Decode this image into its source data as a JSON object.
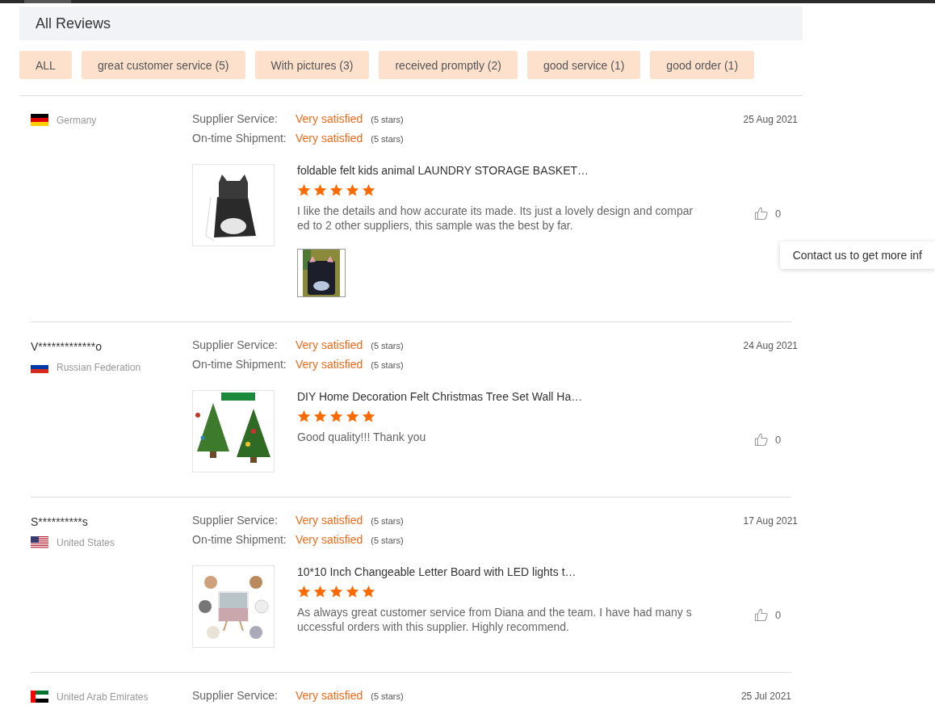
{
  "section": {
    "title": "All Reviews"
  },
  "filters": [
    {
      "label": "ALL"
    },
    {
      "label": "great customer service (5)"
    },
    {
      "label": "With pictures (3)"
    },
    {
      "label": "received promptly (2)"
    },
    {
      "label": "good service (1)"
    },
    {
      "label": "good order (1)"
    }
  ],
  "reviews": [
    {
      "country": "Germany",
      "date": "25 Aug 2021",
      "ratings": [
        {
          "label": "Supplier Service:",
          "value": "Very satisfied",
          "note": "(5 stars)"
        },
        {
          "label": "On-time Shipment:",
          "value": "Very satisfied",
          "note": "(5 stars)"
        }
      ],
      "product": {
        "title": "foldable felt kids animal LAUNDRY STORAGE BASKET…"
      },
      "stars": 5,
      "comment": "I like the details and how accurate its made. Its just a lovely design and compared to 2 other suppliers, this sample was the best by far.",
      "photos": [
        {
          "kind": "picture"
        }
      ],
      "likes": "0"
    },
    {
      "reviewer": "V*************o",
      "country": "Russian Federation",
      "date": "24 Aug 2021",
      "ratings": [
        {
          "label": "Supplier Service:",
          "value": "Very satisfied",
          "note": "(5 stars)"
        },
        {
          "label": "On-time Shipment:",
          "value": "Very satisfied",
          "note": "(5 stars)"
        }
      ],
      "product": {
        "title": "DIY Home Decoration Felt Christmas Tree Set Wall Ha…"
      },
      "stars": 5,
      "comment": "Good quality!!! Thank you",
      "likes": "0"
    },
    {
      "reviewer": "S**********s",
      "country": "United States",
      "date": "17 Aug 2021",
      "ratings": [
        {
          "label": "Supplier Service:",
          "value": "Very satisfied",
          "note": "(5 stars)"
        },
        {
          "label": "On-time Shipment:",
          "value": "Very satisfied",
          "note": "(5 stars)"
        }
      ],
      "product": {
        "title": "10*10 Inch Changeable Letter Board with LED lights t…"
      },
      "stars": 5,
      "comment": "As always great customer service from Diana and the team. I have had many successful orders with this supplier. Highly recommend.",
      "likes": "0"
    },
    {
      "country": "United Arab Emirates",
      "date": "25 Jul 2021",
      "ratings": [
        {
          "label": "Supplier Service:",
          "value": "Very satisfied",
          "note": "(5 stars)"
        }
      ]
    }
  ],
  "contact_tab": {
    "label": "Contact us to get more inf"
  }
}
